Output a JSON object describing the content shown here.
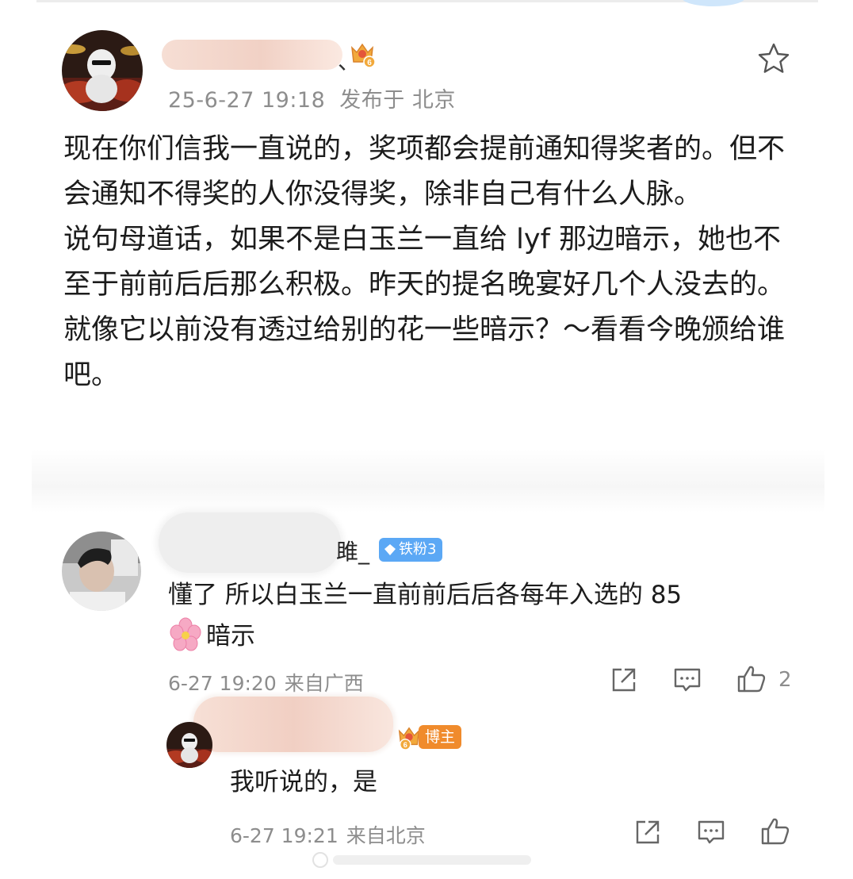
{
  "post": {
    "author_name_partial": "、",
    "timestamp": "25-6-27 19:18",
    "location": "发布于 北京",
    "paragraphs": [
      "现在你们信我一直说的，奖项都会提前通知得奖者的。但不会通知不得奖的人你没得奖，除非自己有什么人脉。",
      "说句母道话，如果不是白玉兰一直给 lyf 那边暗示，她也不至于前前后后那么积极。昨天的提名晚宴好几个人没去的。就像它以前没有透过给别的花一些暗示？～看看今晚颁给谁吧。"
    ],
    "level_badge": "6"
  },
  "comments": [
    {
      "name_partial": "雎_",
      "fan_badge": "铁粉3",
      "text_line1": "懂了 所以白玉兰一直前前后后各每年入选的 85",
      "text_line2": "暗示",
      "timestamp": "6-27 19:20",
      "location": "来自广西",
      "like_count": "2"
    }
  ],
  "reply": {
    "blogger_badge": "博主",
    "level_badge": "6",
    "text": "我听说的，是",
    "timestamp": "6-27 19:21",
    "location": "来自北京"
  },
  "icons": {
    "star": "star-icon",
    "share": "share-icon",
    "comment": "comment-icon",
    "like": "thumbs-up-icon"
  },
  "colors": {
    "meta_gray": "#8d8d8d",
    "fan_badge": "#5ba8f5",
    "blogger_badge": "#f08b2c",
    "crown_gold": "#f2a93b"
  }
}
